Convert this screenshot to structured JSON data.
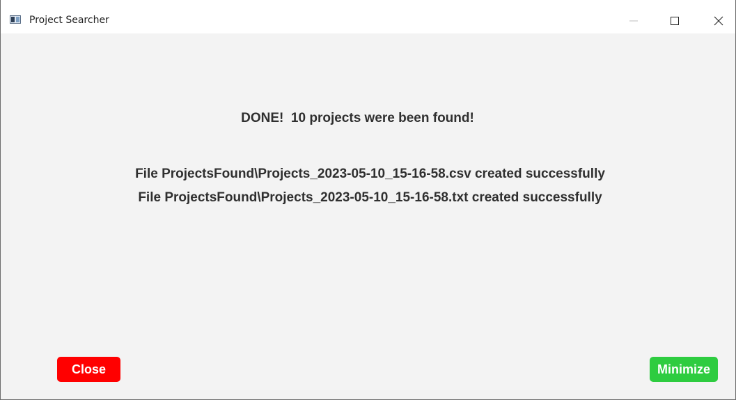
{
  "window": {
    "title": "Project Searcher"
  },
  "message": {
    "done": "DONE!  10 projects were been found!",
    "files": [
      "File ProjectsFound\\Projects_2023-05-10_15-16-58.csv created successfully",
      "File ProjectsFound\\Projects_2023-05-10_15-16-58.txt created successfully"
    ]
  },
  "buttons": {
    "close_label": "Close",
    "minimize_label": "Minimize"
  },
  "colors": {
    "close_button": "#ff0000",
    "minimize_button": "#2ecc40",
    "content_background": "#f3f3f3"
  },
  "icons": {
    "app": "app-window-icon",
    "window_minimize": "minimize-icon",
    "window_maximize": "maximize-icon",
    "window_close": "close-icon"
  }
}
